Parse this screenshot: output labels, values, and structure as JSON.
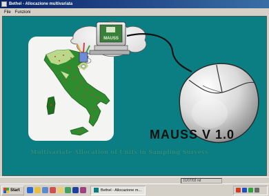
{
  "window": {
    "title": "Bethel - Allocazione multivariata",
    "menu": [
      "File",
      "Funzioni"
    ]
  },
  "splash": {
    "computer_screen_text": "MAUSS",
    "title": "MAUSS V 1.0",
    "subtitle": "Multivariate Allocation of Units in Sampling Surveys"
  },
  "statusbar": {
    "field_text": "31/07/03 nd"
  },
  "taskbar": {
    "start_label": "Start",
    "task_label": "Bethel - Allocazione m...",
    "quick_launch_icons": [
      "ie-icon",
      "outlook-icon",
      "desktop-icon",
      "media-icon",
      "folder-icon",
      "app-icon",
      "app2-icon",
      "app3-icon"
    ],
    "tray_icons": [
      "network-icon",
      "volume-icon",
      "security-icon",
      "lang-icon"
    ]
  },
  "colors": {
    "background": "#0a7e82",
    "title_text": "#101010",
    "subtitle_text": "#2b8f84",
    "italy_fill": "#2e8b2e",
    "titlebar": "#0a246a"
  }
}
